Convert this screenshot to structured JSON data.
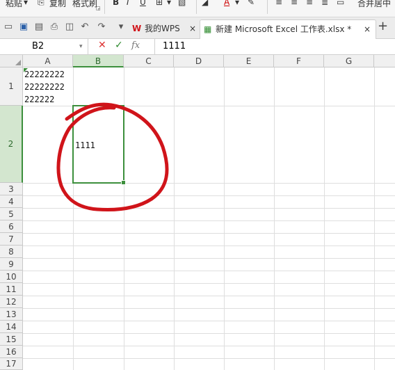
{
  "ribbon": {
    "paste": "粘贴",
    "copy": "复制",
    "format_painter": "格式刷",
    "bold": "B",
    "italic": "I",
    "underline": "U",
    "font_color": "A",
    "merge_center": "合并居中"
  },
  "quick_bar": {
    "tab_wps": "我的WPS",
    "tab_doc": "新建 Microsoft Excel 工作表.xlsx *",
    "close": "×",
    "add": "+"
  },
  "formula_bar": {
    "cell_ref": "B2",
    "fx": "fx",
    "value": "1111"
  },
  "columns": [
    "A",
    "B",
    "C",
    "D",
    "E",
    "F",
    "G"
  ],
  "rows": [
    "1",
    "2",
    "3",
    "4",
    "5",
    "6",
    "7",
    "8",
    "9",
    "10",
    "11",
    "12",
    "13",
    "14",
    "15",
    "16",
    "17"
  ],
  "cells": {
    "A1": "22222222\n22222222\n222222",
    "B2": "1111"
  },
  "selection": {
    "active_cell": "B2"
  },
  "annotation": {
    "color": "#d0141a"
  },
  "colors": {
    "selection_border": "#3c8f3c",
    "selected_header_bg": "#d3e6cf",
    "wps_red": "#d0141a"
  }
}
